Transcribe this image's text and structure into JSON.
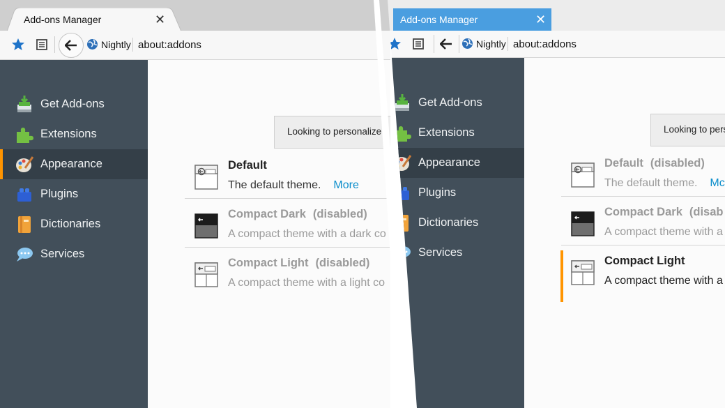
{
  "left": {
    "tab": {
      "title": "Add-ons Manager",
      "close": "✕"
    },
    "identity": "Nightly",
    "url": "about:addons",
    "categories": [
      {
        "label": "Get Add-ons",
        "icon": "get-addons-icon"
      },
      {
        "label": "Extensions",
        "icon": "puzzle-icon"
      },
      {
        "label": "Appearance",
        "icon": "palette-icon"
      },
      {
        "label": "Plugins",
        "icon": "lego-icon"
      },
      {
        "label": "Dictionaries",
        "icon": "book-icon"
      },
      {
        "label": "Services",
        "icon": "chat-icon"
      }
    ],
    "selected_category": "Appearance",
    "notice": "Looking to personalize y",
    "themes": [
      {
        "name": "Default",
        "status": "",
        "desc": "The default theme.",
        "more": "More"
      },
      {
        "name": "Compact Dark",
        "status": "(disabled)",
        "desc": "A compact theme with a dark co"
      },
      {
        "name": "Compact Light",
        "status": "(disabled)",
        "desc": "A compact theme with a light co"
      }
    ]
  },
  "right": {
    "tab": {
      "title": "Add-ons Manager",
      "close": "✕"
    },
    "identity": "Nightly",
    "url": "about:addons",
    "categories": [
      {
        "label": "Get Add-ons"
      },
      {
        "label": "Extensions"
      },
      {
        "label": "Appearance"
      },
      {
        "label": "Plugins"
      },
      {
        "label": "Dictionaries"
      },
      {
        "label": "Services"
      }
    ],
    "selected_category": "Appearance",
    "notice": "Looking to pers",
    "themes": [
      {
        "name": "Default",
        "status": "(disabled)",
        "desc": "The default theme.",
        "more": "Mc"
      },
      {
        "name": "Compact Dark",
        "status": "(disab",
        "desc": "A compact theme with a"
      },
      {
        "name": "Compact Light",
        "status": "",
        "desc": "A compact theme with a"
      }
    ]
  },
  "colors": {
    "sidebar": "#424f5a",
    "sidebar_selected": "#343f48",
    "accent": "#ff9400",
    "link": "#0a8dcb",
    "active_tab_blue": "#4a9ee0"
  }
}
